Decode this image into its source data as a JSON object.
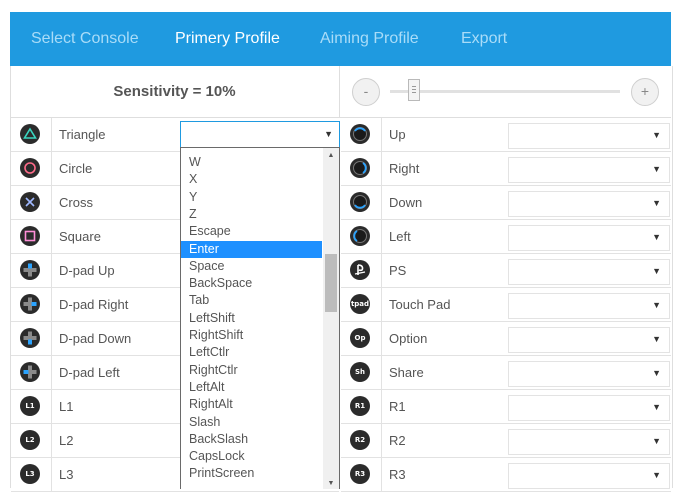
{
  "tabs": [
    "Select Console",
    "Primery Profile",
    "Aiming Profile",
    "Export"
  ],
  "active_tab": "Primery Profile",
  "sensitivity": {
    "text": "Sensitivity = 10%",
    "value": 0.1,
    "minus": "-",
    "plus": "+"
  },
  "left_rows": [
    {
      "label": "Triangle",
      "icon": "triangle-icon"
    },
    {
      "label": "Circle",
      "icon": "circle-icon"
    },
    {
      "label": "Cross",
      "icon": "cross-icon"
    },
    {
      "label": "Square",
      "icon": "square-icon"
    },
    {
      "label": "D-pad Up",
      "icon": "dpad-up-icon"
    },
    {
      "label": "D-pad Right",
      "icon": "dpad-right-icon"
    },
    {
      "label": "D-pad Down",
      "icon": "dpad-down-icon"
    },
    {
      "label": "D-pad Left",
      "icon": "dpad-left-icon"
    },
    {
      "label": "L1",
      "icon": "l1-icon",
      "glyph": "L1"
    },
    {
      "label": "L2",
      "icon": "l2-icon",
      "glyph": "L2"
    },
    {
      "label": "L3",
      "icon": "l3-icon",
      "glyph": "L3"
    }
  ],
  "right_rows": [
    {
      "label": "Up",
      "icon": "stick-up-icon"
    },
    {
      "label": "Right",
      "icon": "stick-right-icon"
    },
    {
      "label": "Down",
      "icon": "stick-down-icon"
    },
    {
      "label": "Left",
      "icon": "stick-left-icon"
    },
    {
      "label": "PS",
      "icon": "playstation-icon"
    },
    {
      "label": "Touch Pad",
      "icon": "touchpad-icon",
      "glyph": "tpad"
    },
    {
      "label": "Option",
      "icon": "option-icon",
      "glyph": "Op"
    },
    {
      "label": "Share",
      "icon": "share-icon",
      "glyph": "Sh"
    },
    {
      "label": "R1",
      "icon": "r1-icon",
      "glyph": "R1"
    },
    {
      "label": "R2",
      "icon": "r2-icon",
      "glyph": "R2"
    },
    {
      "label": "R3",
      "icon": "r3-icon",
      "glyph": "R3"
    }
  ],
  "dropdown": {
    "selected": "",
    "options": [
      "W",
      "X",
      "Y",
      "Z",
      "Escape",
      "Enter",
      "Space",
      "BackSpace",
      "Tab",
      "LeftShift",
      "RightShift",
      "LeftCtlr",
      "RightCtlr",
      "LeftAlt",
      "RightAlt",
      "Slash",
      "BackSlash",
      "CapsLock",
      "PrintScreen"
    ],
    "highlighted": "Enter"
  },
  "colors": {
    "accent": "#1f9ae0",
    "highlight": "#1e90ff",
    "tab_inactive": "#a9dcf8"
  }
}
